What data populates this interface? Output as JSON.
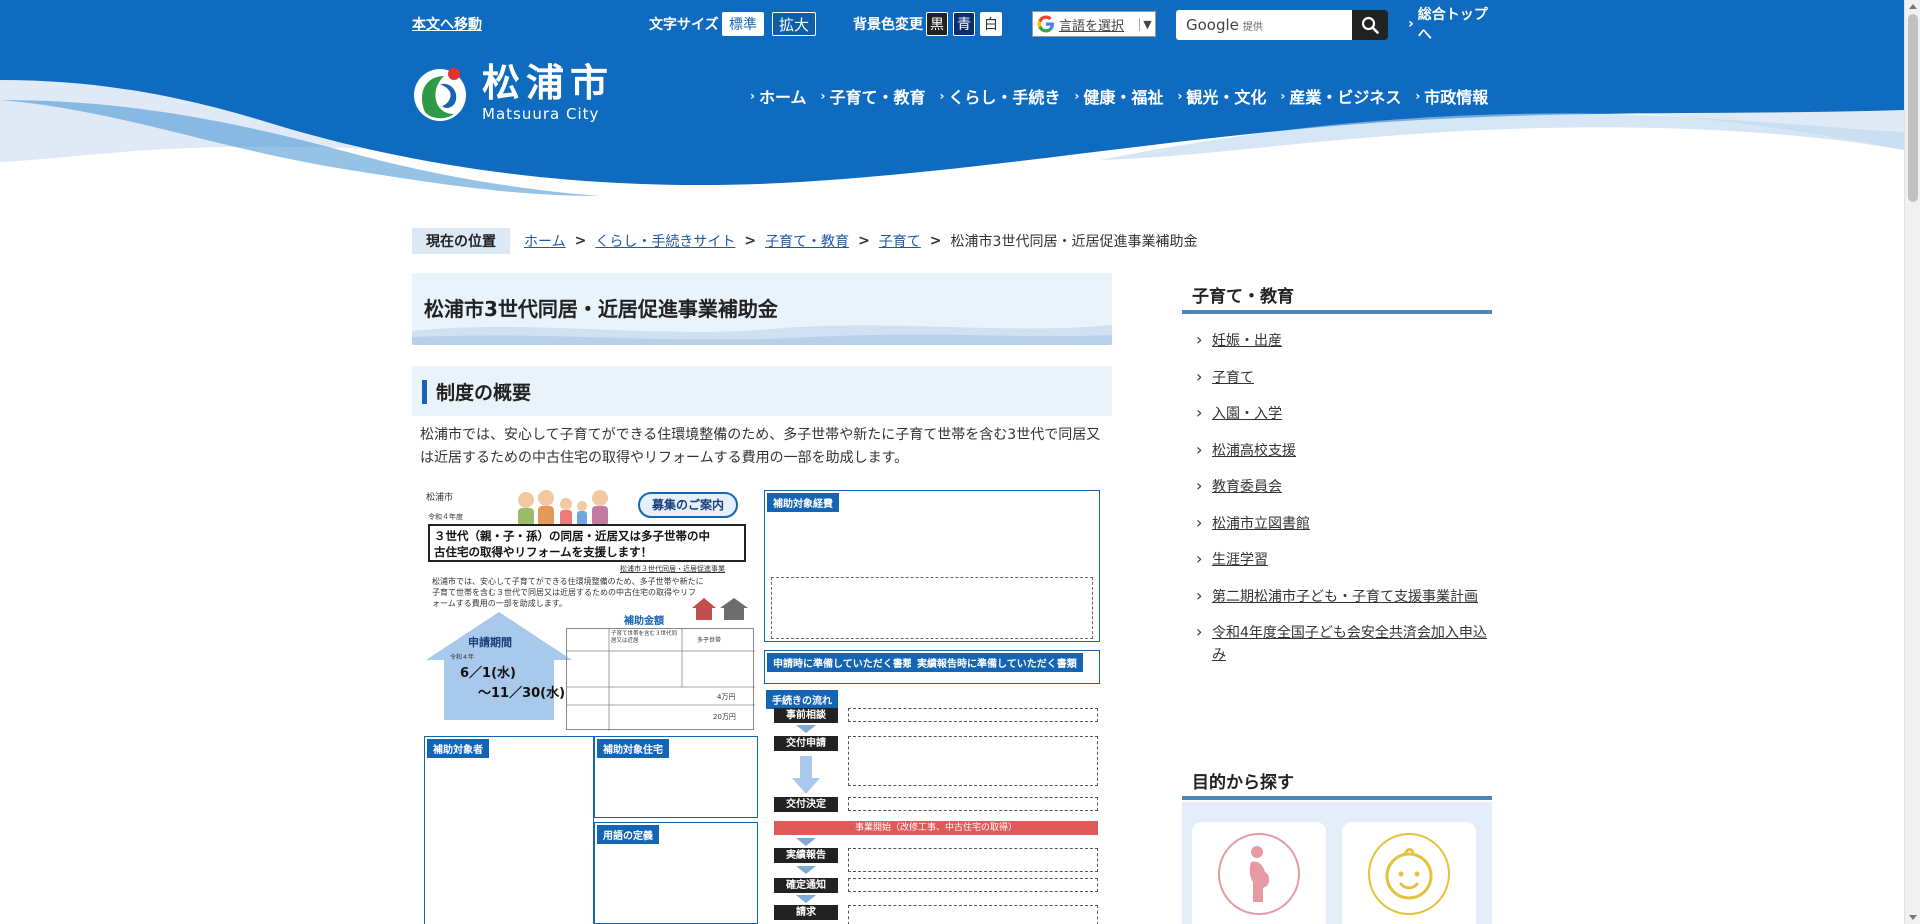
{
  "colors": {
    "header_blue": "#0e6bbf",
    "light_wave": "#dfeaf6",
    "accent": "#1565b5",
    "link": "#1e5aa5"
  },
  "utility": {
    "skip_link": "本文へ移動",
    "font_size_label": "文字サイズ",
    "font_standard": "標準",
    "font_large": "拡大",
    "bg_label": "背景色変更",
    "bg_black": "黒",
    "bg_blue": "青",
    "bg_white": "白",
    "language_select": "言語を選択",
    "language_arrow": "▼",
    "search_brand": "Google",
    "search_provider": "提供",
    "portal_link": "総合トップへ"
  },
  "logo": {
    "name_jp": "松浦市",
    "name_en": "Matsuura City"
  },
  "gnav": [
    {
      "label": "ホーム"
    },
    {
      "label": "子育て・教育"
    },
    {
      "label": "くらし・手続き"
    },
    {
      "label": "健康・福祉"
    },
    {
      "label": "観光・文化"
    },
    {
      "label": "産業・ビジネス"
    },
    {
      "label": "市政情報"
    }
  ],
  "breadcrumb": {
    "label": "現在の位置",
    "items": [
      "ホーム",
      "くらし・手続きサイト",
      "子育て・教育",
      "子育て"
    ],
    "separator": ">",
    "current": "松浦市3世代同居・近居促進事業補助金"
  },
  "main": {
    "page_title": "松浦市3世代同居・近居促進事業補助金",
    "section_title": "制度の概要",
    "summary": "松浦市では、安心して子育てができる住環境整備のため、多子世帯や新たに子育て世帯を含む3世代で同居又は近居するための中古住宅の取得やリフォームする費用の一部を助成します。"
  },
  "flyer": {
    "city": "松浦市",
    "year": "令和４年度",
    "recruit": "募集のご案内",
    "headline_1": "３世代（親・子・孫）の同居・近居又は多子世帯の中",
    "headline_2": "古住宅の取得やリフォームを支援します！",
    "program_name": "松浦市３世代同居・近居促進事業",
    "intro_1": "松浦市では、安心して子育てができる住環境整備のため、多子世帯や新たに",
    "intro_2": "子育て世帯を含む３世代で同居又は近居するための中古住宅の取得やリフ",
    "intro_3": "ォームする費用の一部を助成します。",
    "subsidy_amount": "補助金額",
    "period_title": "申請期間",
    "period_year": "令和４年",
    "period_start": "6／1(水)",
    "period_end": "～11／30(水)",
    "eligible_expenses": "補助対象経費",
    "eligible_person": "補助対象者",
    "eligible_housing": "補助対象住宅",
    "definitions": "用語の定義",
    "docs_apply": "申請時に準備していただく書類",
    "docs_report": "実績報告時に準備していただく書類",
    "flow_title": "手続きの流れ",
    "flow_steps": [
      "事前相談",
      "交付申請",
      "交付決定",
      "実績報告",
      "確定通知",
      "請求"
    ],
    "flow_start": "事業開始（改修工事、中古住宅の取得）",
    "table_col_1": "子育て世帯を含む３世代同居又は近居",
    "table_col_2": "多子世帯",
    "table_amount_1": "4万円",
    "table_amount_2": "20万円"
  },
  "sidebar": {
    "title": "子育て・教育",
    "items": [
      "妊娠・出産",
      "子育て",
      "入園・入学",
      "松浦高校支援",
      "教育委員会",
      "松浦市立図書館",
      "生涯学習",
      "第二期松浦市子ども・子育て支援事業計画",
      "令和4年度全国子ども会安全共済会加入申込み"
    ],
    "find_title": "目的から探す"
  }
}
